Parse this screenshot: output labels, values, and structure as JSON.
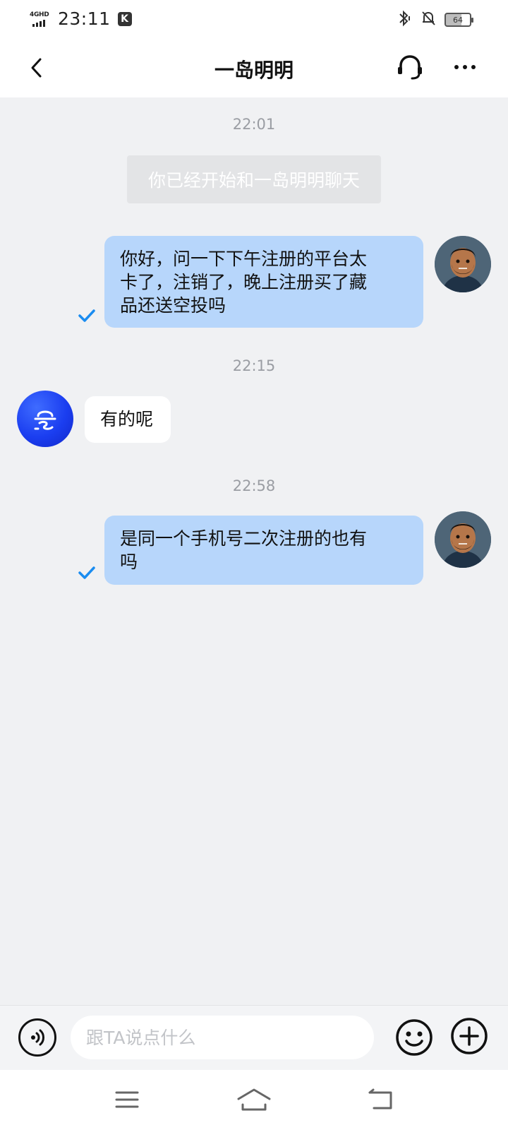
{
  "status_bar": {
    "network": "4GHD",
    "time": "23:11",
    "app_badge": "K",
    "battery": "64"
  },
  "header": {
    "title": "一岛明明",
    "back_icon": "chevron-left-icon",
    "support_icon": "headset-icon",
    "more_icon": "more-dots-icon"
  },
  "chat": {
    "system_notice": "你已经开始和一岛明明聊天",
    "items": [
      {
        "time": "22:01"
      },
      {
        "from": "me",
        "lines": [
          "你好，问一下下午注册的平台太",
          "卡了，注销了，晚上注册买了藏",
          "品还送空投吗"
        ],
        "status": "read"
      },
      {
        "time": "22:15"
      },
      {
        "from": "them",
        "lines": [
          "有的呢"
        ]
      },
      {
        "time": "22:58"
      },
      {
        "from": "me",
        "lines": [
          "是同一个手机号二次注册的也有",
          "吗"
        ],
        "status": "read"
      }
    ]
  },
  "input_bar": {
    "placeholder": "跟TA说点什么",
    "value": "",
    "voice_icon": "voice-icon",
    "emoji_icon": "smiley-icon",
    "plus_icon": "plus-circle-icon"
  },
  "nav_bar": {
    "menu_icon": "menu-icon",
    "home_icon": "home-icon",
    "back_icon": "back-arrow-icon"
  },
  "colors": {
    "my_bubble": "#b7d6fb",
    "their_bubble": "#ffffff",
    "background": "#f0f1f3",
    "check": "#1a8cf0",
    "bot_avatar": "#1b3ef0"
  }
}
